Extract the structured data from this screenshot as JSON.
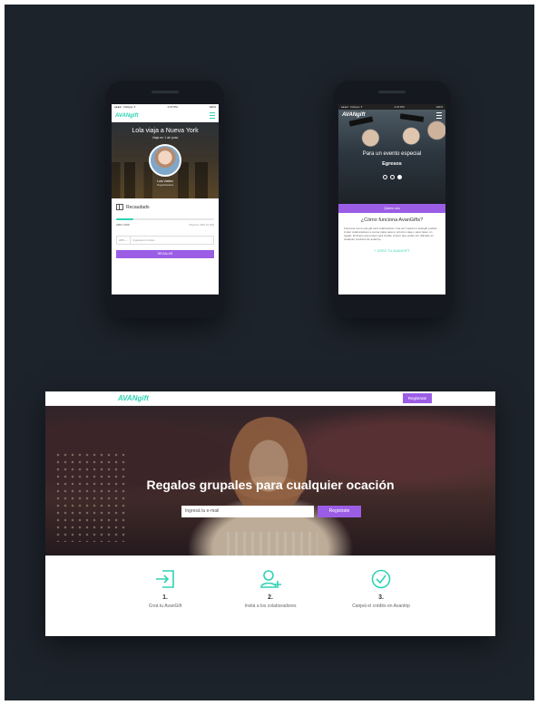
{
  "colors": {
    "accent": "#2fd3b3",
    "purple": "#9b5de5",
    "background": "#1d232b"
  },
  "phone1": {
    "status": {
      "carrier": "●●●●○ Voltiyan ✦",
      "time": "4:15 PM",
      "battery": "100%"
    },
    "logo": "AVANgift",
    "hero_title": "Lola viaja a Nueva York",
    "hero_subtitle": "Viaja en 1 de junio",
    "person_name": "Lola Valdez",
    "person_role": "Organizadora",
    "collected_label": "Recaudado",
    "progress_percent": 18,
    "amount": "ARS 1.000",
    "amount_note": "Objetivo ARS 10.000",
    "currency": "ARS ⌄",
    "amount_placeholder": "Ingresá un monto...",
    "gift_button": "REGALAR"
  },
  "phone2": {
    "status": {
      "carrier": "●●●●○ Voltiyan ✦",
      "time": "4:15 PM",
      "battery": "100%"
    },
    "logo": "AVANgift",
    "hero_title": "Para un evento especial",
    "hero_subtitle": "Egresos",
    "band_button": "Quiero uno",
    "question": "¿Cómo funciona AvanGifts?",
    "description": "Funciona como una gift card colaborativa. Una vez creado tu avangift podrás invitar colaboradores a sumar plata para tu próximo viaje o para hacer un regalo. El dinero que juntes será crédito a favor que podés ser utilizado en cualquier producto de avantrip.",
    "more_link": "+ CREÁ TU AVANGIFT"
  },
  "desktop": {
    "logo": "AVANgift",
    "register_button": "Registrate",
    "hero_title": "Regalos grupales para cualquier ocación",
    "email_placeholder": "Ingresá tu e-mail",
    "hero_button": "Registrate",
    "steps": [
      {
        "number": "1.",
        "label": "Creá tu AvanGift",
        "icon": "enter-icon"
      },
      {
        "number": "2.",
        "label": "Invitá a los colaboradores",
        "icon": "add-user-icon"
      },
      {
        "number": "3.",
        "label": "Canjeá el crédito en Avantrip",
        "icon": "check-circle-icon"
      }
    ]
  }
}
